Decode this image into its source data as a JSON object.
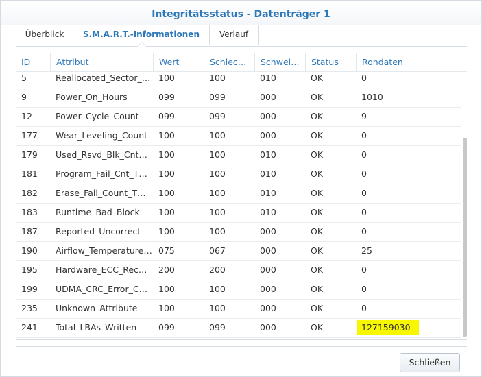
{
  "window": {
    "title": "Integritätsstatus - Datenträger 1"
  },
  "tabs": [
    {
      "label": "Überblick",
      "active": false
    },
    {
      "label": "S.M.A.R.T.-Informationen",
      "active": true
    },
    {
      "label": "Verlauf",
      "active": false
    }
  ],
  "table": {
    "columns": [
      "ID",
      "Attribut",
      "Wert",
      "Schlec…",
      "Schwel…",
      "Status",
      "Rohdaten"
    ],
    "rows": [
      [
        "5",
        "Reallocated_Sector_…",
        "100",
        "100",
        "010",
        "OK",
        "0"
      ],
      [
        "9",
        "Power_On_Hours",
        "099",
        "099",
        "000",
        "OK",
        "1010"
      ],
      [
        "12",
        "Power_Cycle_Count",
        "099",
        "099",
        "000",
        "OK",
        "9"
      ],
      [
        "177",
        "Wear_Leveling_Count",
        "100",
        "100",
        "000",
        "OK",
        "0"
      ],
      [
        "179",
        "Used_Rsvd_Blk_Cnt…",
        "100",
        "100",
        "010",
        "OK",
        "0"
      ],
      [
        "181",
        "Program_Fail_Cnt_T…",
        "100",
        "100",
        "010",
        "OK",
        "0"
      ],
      [
        "182",
        "Erase_Fail_Count_T…",
        "100",
        "100",
        "010",
        "OK",
        "0"
      ],
      [
        "183",
        "Runtime_Bad_Block",
        "100",
        "100",
        "010",
        "OK",
        "0"
      ],
      [
        "187",
        "Reported_Uncorrect",
        "100",
        "100",
        "000",
        "OK",
        "0"
      ],
      [
        "190",
        "Airflow_Temperature…",
        "075",
        "067",
        "000",
        "OK",
        "25"
      ],
      [
        "195",
        "Hardware_ECC_Rec…",
        "200",
        "200",
        "000",
        "OK",
        "0"
      ],
      [
        "199",
        "UDMA_CRC_Error_C…",
        "100",
        "100",
        "000",
        "OK",
        "0"
      ],
      [
        "235",
        "Unknown_Attribute",
        "100",
        "100",
        "000",
        "OK",
        "0"
      ],
      [
        "241",
        "Total_LBAs_Written",
        "099",
        "099",
        "000",
        "OK",
        "127159030"
      ]
    ],
    "highlight_color": "#f7f700"
  },
  "footer": {
    "close_label": "Schließen"
  },
  "colors": {
    "accent": "#2e78b8",
    "text": "#333333",
    "border": "#d6dde4"
  }
}
